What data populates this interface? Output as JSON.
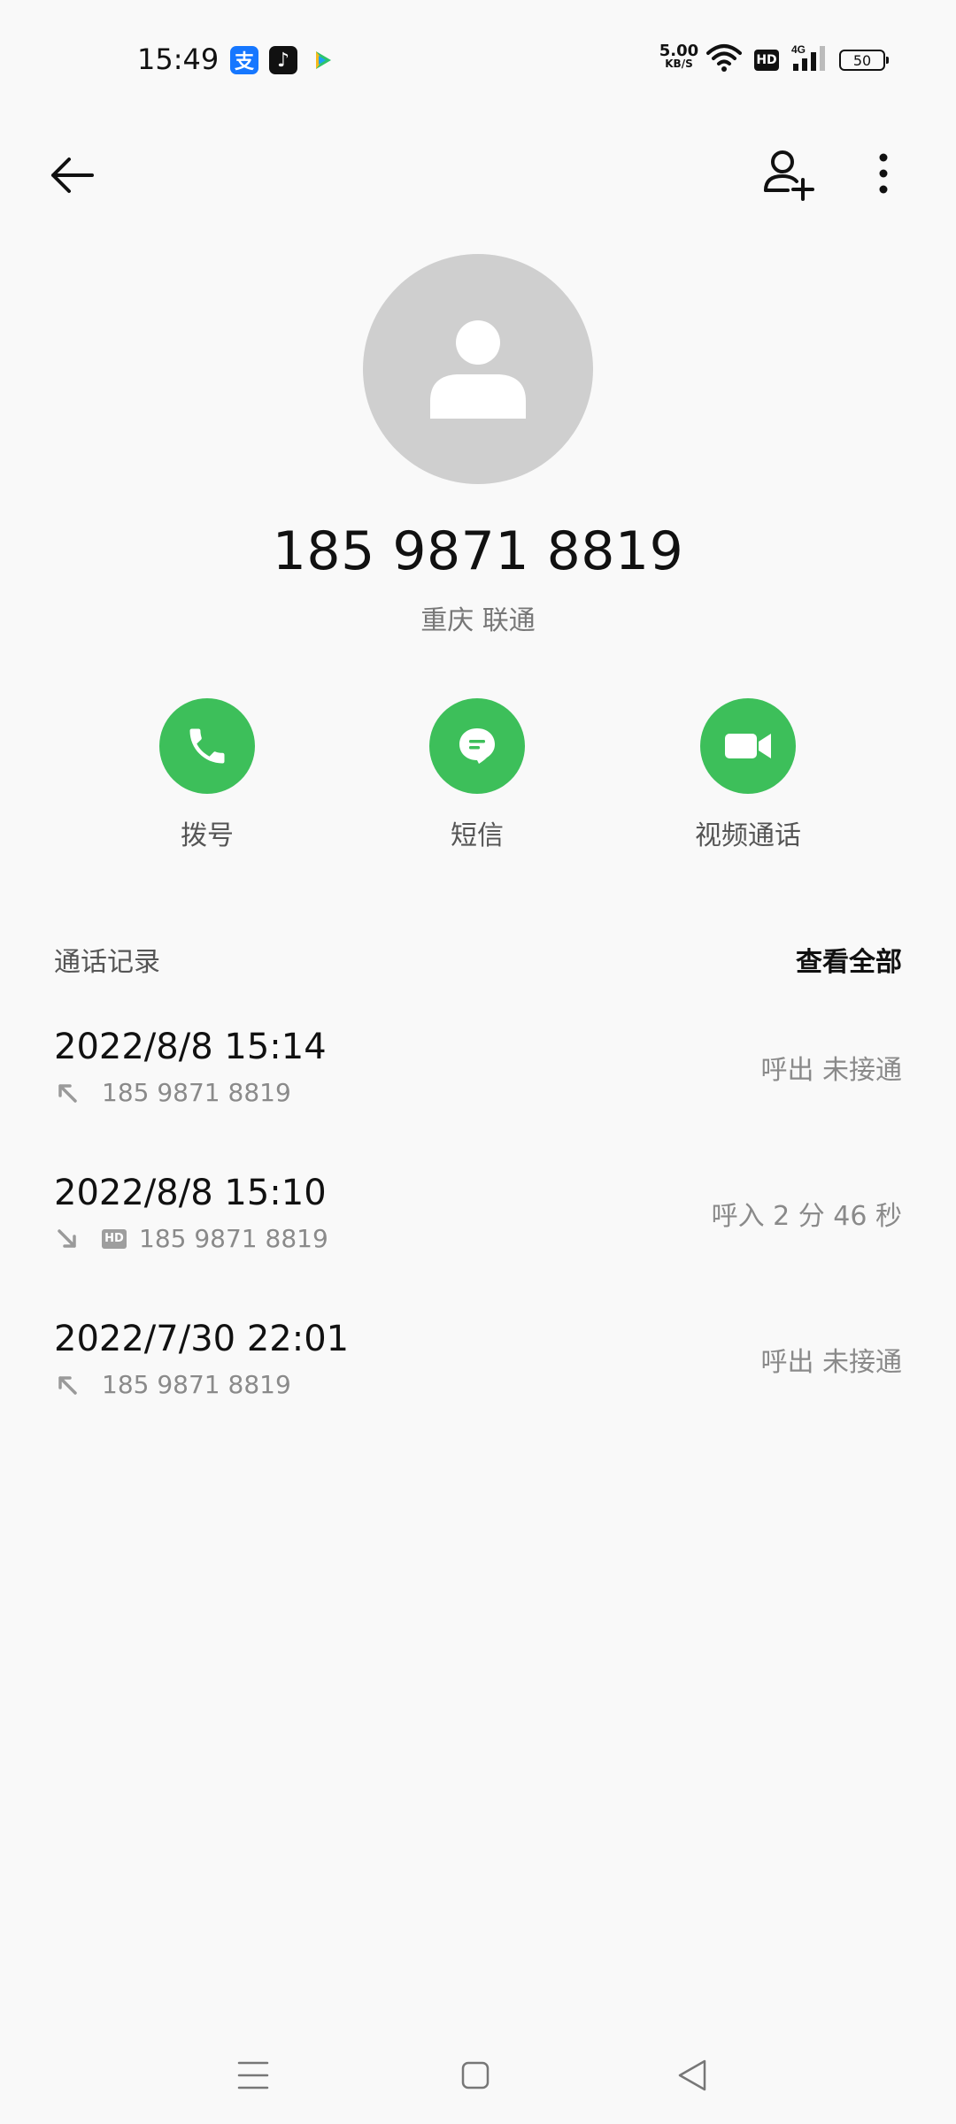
{
  "status_bar": {
    "time": "15:49",
    "net_speed_value": "5.00",
    "net_speed_unit": "KB/S",
    "hd": "HD",
    "network": "4G",
    "battery": "50",
    "apps": [
      {
        "name": "alipay-icon",
        "glyph": "支"
      },
      {
        "name": "tiktok-icon",
        "glyph": "♪"
      },
      {
        "name": "video-app-icon"
      }
    ]
  },
  "contact": {
    "number": "185 9871 8819",
    "carrier": "重庆 联通"
  },
  "actions": {
    "dial": "拨号",
    "sms": "短信",
    "video": "视频通话"
  },
  "call_log": {
    "title": "通话记录",
    "view_all": "查看全部",
    "entries": [
      {
        "date": "2022/8/8 15:14",
        "direction": "outgoing",
        "hd": false,
        "number": "185 9871 8819",
        "status": "呼出 未接通"
      },
      {
        "date": "2022/8/8 15:10",
        "direction": "incoming",
        "hd": true,
        "hd_label": "HD",
        "number": "185 9871 8819",
        "status": "呼入  2 分 46 秒"
      },
      {
        "date": "2022/7/30 22:01",
        "direction": "outgoing",
        "hd": false,
        "number": "185 9871 8819",
        "status": "呼出 未接通"
      }
    ]
  },
  "colors": {
    "accent_green": "#3dbf5a",
    "avatar_gray": "#cfcfcf",
    "background": "#f9f9f9"
  }
}
